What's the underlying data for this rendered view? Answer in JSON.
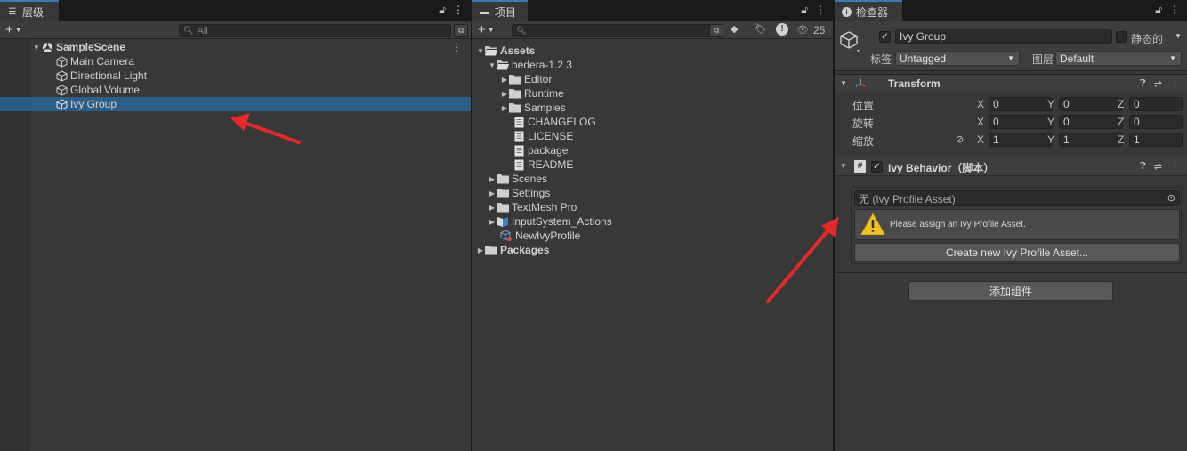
{
  "hierarchy": {
    "tab_label": "层级",
    "tab_icon": "list-icon",
    "search_placeholder": "All",
    "scene": "SampleScene",
    "items": [
      {
        "label": "Main Camera"
      },
      {
        "label": "Directional Light"
      },
      {
        "label": "Global Volume"
      },
      {
        "label": "Ivy Group",
        "selected": true
      }
    ]
  },
  "project": {
    "tab_label": "项目",
    "tab_icon": "folder-icon",
    "hidden_count": "25",
    "tree": {
      "assets": "Assets",
      "hedera": "hedera-1.2.3",
      "editor": "Editor",
      "runtime": "Runtime",
      "samples": "Samples",
      "changelog": "CHANGELOG",
      "license": "LICENSE",
      "package": "package",
      "readme": "README",
      "scenes": "Scenes",
      "settings": "Settings",
      "textmesh": "TextMesh Pro",
      "inputsystem": "InputSystem_Actions",
      "newivy": "NewIvyProfile",
      "packages": "Packages"
    }
  },
  "inspector": {
    "tab_label": "检查器",
    "tab_icon": "info-icon",
    "object_name": "Ivy Group",
    "static_label": "静态的",
    "tag_label": "标签",
    "tag_value": "Untagged",
    "layer_label": "图层",
    "layer_value": "Default",
    "transform": {
      "title": "Transform",
      "position_label": "位置",
      "rotation_label": "旋转",
      "scale_label": "缩放",
      "x": "X",
      "y": "Y",
      "z": "Z",
      "position": [
        "0",
        "0",
        "0"
      ],
      "rotation": [
        "0",
        "0",
        "0"
      ],
      "scale": [
        "1",
        "1",
        "1"
      ]
    },
    "ivy": {
      "title": "Ivy Behavior（脚本）",
      "profile_field": "无 (Ivy Profile Asset)",
      "warning": "Please assign an Ivy Profile Asset.",
      "create_button": "Create new Ivy Profile Asset..."
    },
    "add_component": "添加组件"
  },
  "colors": {
    "selection": "#2c5d87",
    "annotation_arrow": "#e8292b",
    "tab_accent": "#3a79bb"
  }
}
